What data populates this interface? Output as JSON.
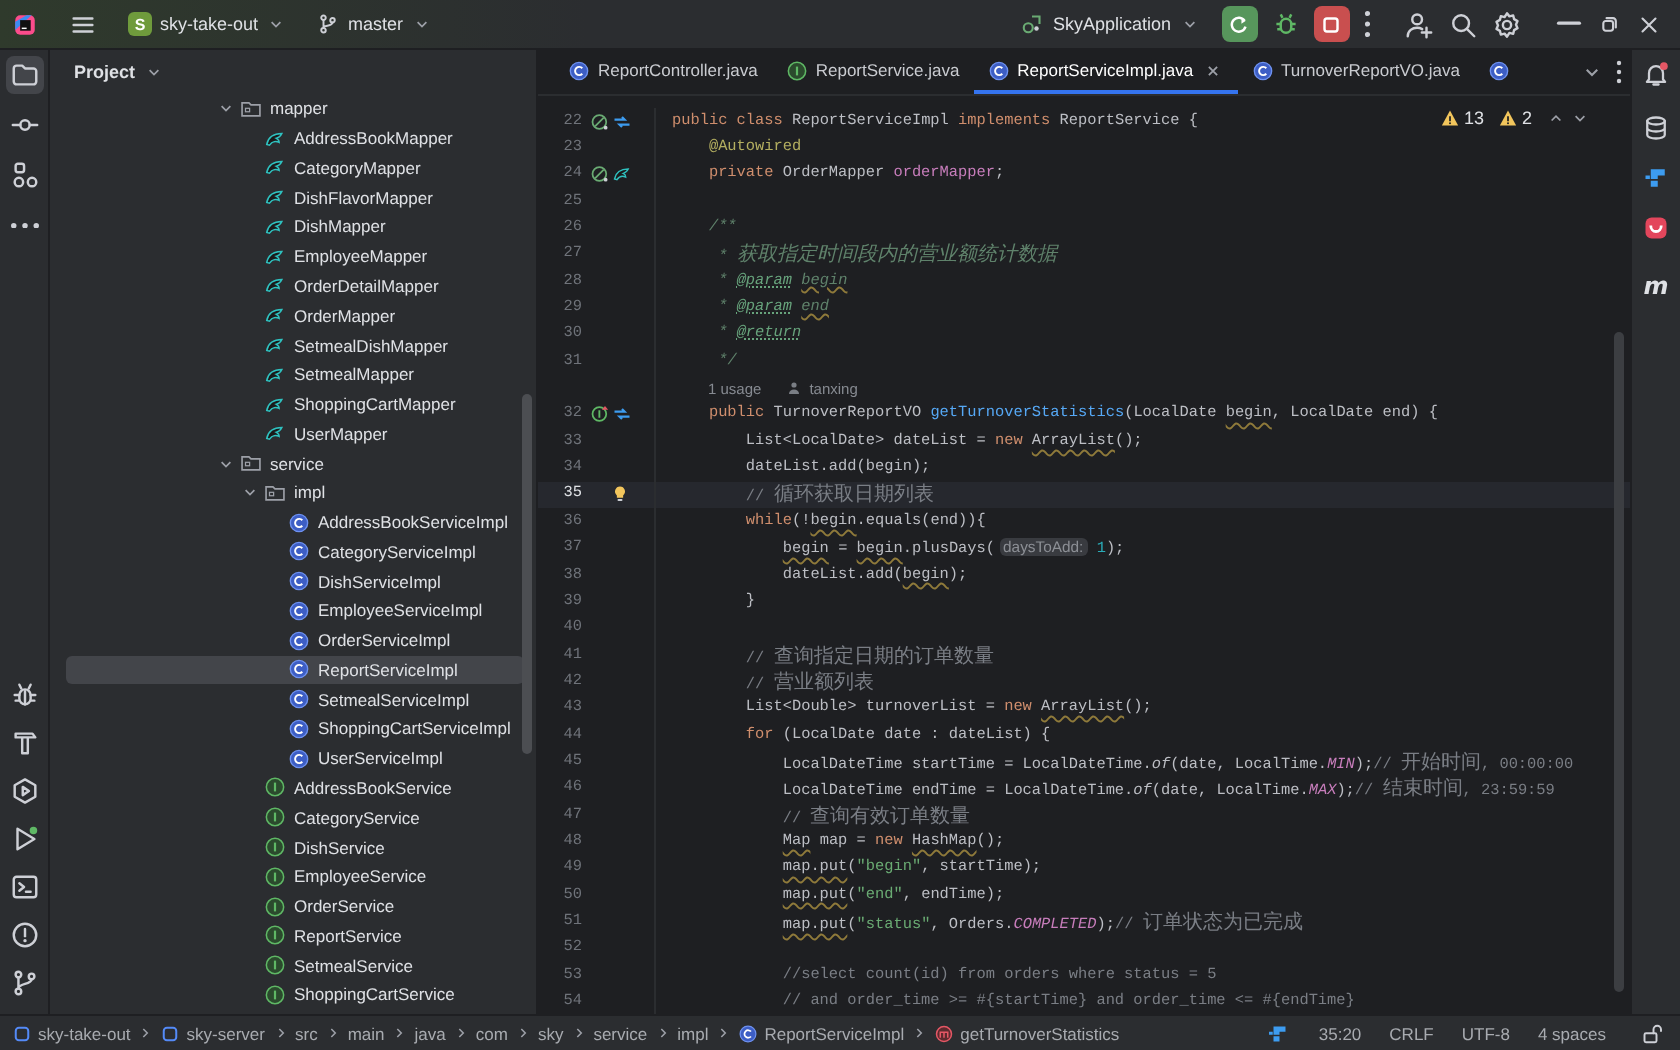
{
  "toolbar": {
    "project": {
      "badge": "S",
      "name": "sky-take-out"
    },
    "branch": "master",
    "run_config": "SkyApplication"
  },
  "tool_windows": {
    "top": [
      {
        "kind": "project",
        "selected": true
      },
      {
        "kind": "commit",
        "selected": false
      },
      {
        "kind": "structure",
        "selected": false
      },
      {
        "kind": "more",
        "selected": false
      }
    ],
    "bottom": [
      {
        "kind": "debug",
        "selected": false
      },
      {
        "kind": "build",
        "selected": false
      },
      {
        "kind": "services",
        "selected": false
      },
      {
        "kind": "run",
        "selected": false
      },
      {
        "kind": "terminal",
        "selected": false
      },
      {
        "kind": "problems",
        "selected": false
      },
      {
        "kind": "git",
        "selected": false
      }
    ]
  },
  "right_tools": [
    {
      "kind": "notifications"
    },
    {
      "kind": "database"
    },
    {
      "kind": "plugin"
    },
    {
      "kind": "app"
    },
    {
      "kind": "letter",
      "glyph": "m"
    }
  ],
  "project_panel": {
    "title": "Project",
    "tree": [
      {
        "label": "mapper",
        "kind": "folder",
        "expanded": true,
        "selected": false,
        "children": [
          {
            "label": "AddressBookMapper",
            "kind": "mapper",
            "selected": false
          },
          {
            "label": "CategoryMapper",
            "kind": "mapper",
            "selected": false
          },
          {
            "label": "DishFlavorMapper",
            "kind": "mapper",
            "selected": false
          },
          {
            "label": "DishMapper",
            "kind": "mapper",
            "selected": false
          },
          {
            "label": "EmployeeMapper",
            "kind": "mapper",
            "selected": false
          },
          {
            "label": "OrderDetailMapper",
            "kind": "mapper",
            "selected": false
          },
          {
            "label": "OrderMapper",
            "kind": "mapper",
            "selected": false
          },
          {
            "label": "SetmealDishMapper",
            "kind": "mapper",
            "selected": false
          },
          {
            "label": "SetmealMapper",
            "kind": "mapper",
            "selected": false
          },
          {
            "label": "ShoppingCartMapper",
            "kind": "mapper",
            "selected": false
          },
          {
            "label": "UserMapper",
            "kind": "mapper",
            "selected": false
          }
        ]
      },
      {
        "label": "service",
        "kind": "folder",
        "expanded": true,
        "selected": false,
        "children": [
          {
            "label": "impl",
            "kind": "folder",
            "expanded": true,
            "selected": false,
            "children": [
              {
                "label": "AddressBookServiceImpl",
                "kind": "class",
                "selected": false
              },
              {
                "label": "CategoryServiceImpl",
                "kind": "class",
                "selected": false
              },
              {
                "label": "DishServiceImpl",
                "kind": "class",
                "selected": false
              },
              {
                "label": "EmployeeServiceImpl",
                "kind": "class",
                "selected": false
              },
              {
                "label": "OrderServiceImpl",
                "kind": "class",
                "selected": false
              },
              {
                "label": "ReportServiceImpl",
                "kind": "class",
                "selected": true
              },
              {
                "label": "SetmealServiceImpl",
                "kind": "class",
                "selected": false
              },
              {
                "label": "ShoppingCartServiceImpl",
                "kind": "class",
                "selected": false
              },
              {
                "label": "UserServiceImpl",
                "kind": "class",
                "selected": false
              }
            ]
          },
          {
            "label": "AddressBookService",
            "kind": "interface",
            "selected": false
          },
          {
            "label": "CategoryService",
            "kind": "interface",
            "selected": false
          },
          {
            "label": "DishService",
            "kind": "interface",
            "selected": false
          },
          {
            "label": "EmployeeService",
            "kind": "interface",
            "selected": false
          },
          {
            "label": "OrderService",
            "kind": "interface",
            "selected": false
          },
          {
            "label": "ReportService",
            "kind": "interface",
            "selected": false
          },
          {
            "label": "SetmealService",
            "kind": "interface",
            "selected": false
          },
          {
            "label": "ShoppingCartService",
            "kind": "interface",
            "selected": false
          }
        ]
      }
    ]
  },
  "tabs": [
    {
      "label": "ReportController.java",
      "kind": "class",
      "selected": false
    },
    {
      "label": "ReportService.java",
      "kind": "interface",
      "selected": false
    },
    {
      "label": "ReportServiceImpl.java",
      "kind": "class",
      "selected": true
    },
    {
      "label": "TurnoverReportVO.java",
      "kind": "class",
      "selected": false
    },
    {
      "kind": "class",
      "selected": false
    }
  ],
  "inspections": {
    "warnings": "13",
    "weak_warnings": "2"
  },
  "editor": {
    "lines": [
      {
        "kind": "code",
        "number": "22",
        "current": false,
        "gutter": [
          {
            "kind": "bean"
          },
          {
            "kind": "hierarchy"
          }
        ],
        "tokens": [
          {
            "kind": "kw",
            "text": "public class "
          },
          {
            "kind": "plain",
            "text": "ReportServiceImpl "
          },
          {
            "kind": "kw",
            "text": "implements "
          },
          {
            "kind": "plain",
            "text": "ReportService {"
          }
        ]
      },
      {
        "kind": "code",
        "number": "23",
        "current": false,
        "tokens": [
          {
            "kind": "ann",
            "text": "    @Autowired"
          }
        ]
      },
      {
        "kind": "code",
        "number": "24",
        "current": false,
        "gutter": [
          {
            "kind": "bean"
          },
          {
            "kind": "mapper"
          }
        ],
        "tokens": [
          {
            "kind": "kw",
            "text": "    private "
          },
          {
            "kind": "plain",
            "text": "OrderMapper "
          },
          {
            "kind": "field",
            "text": "orderMapper"
          },
          {
            "kind": "plain",
            "text": ";"
          }
        ]
      },
      {
        "kind": "code",
        "number": "25",
        "current": false
      },
      {
        "kind": "code",
        "number": "26",
        "current": false,
        "tokens": [
          {
            "kind": "doc",
            "text": "    /**"
          }
        ]
      },
      {
        "kind": "code",
        "number": "27",
        "current": false,
        "tokens": [
          {
            "kind": "doc",
            "text": "     * "
          },
          {
            "kind": "doccjk",
            "text": "获取指定时间段内的营业额统计数据"
          }
        ]
      },
      {
        "kind": "code",
        "number": "28",
        "current": false,
        "tokens": [
          {
            "kind": "doc",
            "text": "     * "
          },
          {
            "kind": "doctag",
            "text": "@param"
          },
          {
            "kind": "docname",
            "text": " begin"
          }
        ]
      },
      {
        "kind": "code",
        "number": "29",
        "current": false,
        "tokens": [
          {
            "kind": "doc",
            "text": "     * "
          },
          {
            "kind": "doctag",
            "text": "@param"
          },
          {
            "kind": "docname",
            "text": " end"
          }
        ]
      },
      {
        "kind": "code",
        "number": "30",
        "current": false,
        "tokens": [
          {
            "kind": "doc",
            "text": "     * "
          },
          {
            "kind": "doctag",
            "text": "@return"
          }
        ]
      },
      {
        "kind": "code",
        "number": "31",
        "current": false,
        "tokens": [
          {
            "kind": "doc",
            "text": "     */"
          }
        ]
      },
      {
        "kind": "inlay",
        "usages": "1 usage",
        "author": "tanxing"
      },
      {
        "kind": "code",
        "number": "32",
        "current": false,
        "gutter": [
          {
            "kind": "implements"
          },
          {
            "kind": "hierarchy"
          }
        ],
        "tokens": [
          {
            "kind": "kw",
            "text": "    public "
          },
          {
            "kind": "plain",
            "text": "TurnoverReportVO "
          },
          {
            "kind": "fn",
            "text": "getTurnoverStatistics"
          },
          {
            "kind": "plain",
            "text": "(LocalDate "
          },
          {
            "kind": "warn",
            "text": "begin"
          },
          {
            "kind": "plain",
            "text": ", LocalDate end) {"
          }
        ]
      },
      {
        "kind": "code",
        "number": "33",
        "current": false,
        "tokens": [
          {
            "kind": "plain",
            "text": "        List<LocalDate> dateList = "
          },
          {
            "kind": "kw",
            "text": "new "
          },
          {
            "kind": "warn",
            "text": "ArrayList"
          },
          {
            "kind": "plain",
            "text": "();"
          }
        ]
      },
      {
        "kind": "code",
        "number": "34",
        "current": false,
        "tokens": [
          {
            "kind": "plain",
            "text": "        dateList.add(begin);"
          }
        ]
      },
      {
        "kind": "code",
        "number": "35",
        "current": true,
        "tokens": [
          {
            "kind": "comment",
            "text": "        // "
          },
          {
            "kind": "cjk",
            "text": "循环获取日期列表"
          }
        ]
      },
      {
        "kind": "code",
        "number": "36",
        "current": false,
        "tokens": [
          {
            "kind": "kw",
            "text": "        while"
          },
          {
            "kind": "plain",
            "text": "(!"
          },
          {
            "kind": "warn",
            "text": "begin"
          },
          {
            "kind": "plain",
            "text": ".equals(end)){"
          }
        ]
      },
      {
        "kind": "code",
        "number": "37",
        "current": false,
        "tokens": [
          {
            "kind": "warn",
            "text": "            begin"
          },
          {
            "kind": "plain",
            "text": " = "
          },
          {
            "kind": "warn",
            "text": "begin"
          },
          {
            "kind": "plain",
            "text": ".plusDays("
          },
          {
            "kind": "hint",
            "text": "daysToAdd:"
          },
          {
            "kind": "num",
            "text": " 1"
          },
          {
            "kind": "plain",
            "text": ");"
          }
        ]
      },
      {
        "kind": "code",
        "number": "38",
        "current": false,
        "tokens": [
          {
            "kind": "plain",
            "text": "            dateList.add("
          },
          {
            "kind": "warn",
            "text": "begin"
          },
          {
            "kind": "plain",
            "text": ");"
          }
        ]
      },
      {
        "kind": "code",
        "number": "39",
        "current": false,
        "tokens": [
          {
            "kind": "plain",
            "text": "        }"
          }
        ]
      },
      {
        "kind": "code",
        "number": "40",
        "current": false
      },
      {
        "kind": "code",
        "number": "41",
        "current": false,
        "tokens": [
          {
            "kind": "comment",
            "text": "        // "
          },
          {
            "kind": "cjk",
            "text": "查询指定日期的订单数量"
          }
        ]
      },
      {
        "kind": "code",
        "number": "42",
        "current": false,
        "tokens": [
          {
            "kind": "comment",
            "text": "        // "
          },
          {
            "kind": "cjk",
            "text": "营业额列表"
          }
        ]
      },
      {
        "kind": "code",
        "number": "43",
        "current": false,
        "tokens": [
          {
            "kind": "plain",
            "text": "        List<Double> turnoverList = "
          },
          {
            "kind": "kw",
            "text": "new "
          },
          {
            "kind": "warn",
            "text": "ArrayList"
          },
          {
            "kind": "plain",
            "text": "();"
          }
        ]
      },
      {
        "kind": "code",
        "number": "44",
        "current": false,
        "tokens": [
          {
            "kind": "kw",
            "text": "        for "
          },
          {
            "kind": "plain",
            "text": "(LocalDate date : dateList) {"
          }
        ]
      },
      {
        "kind": "code",
        "number": "45",
        "current": false,
        "tokens": [
          {
            "kind": "plain",
            "text": "            LocalDateTime startTime = LocalDateTime."
          },
          {
            "kind": "static",
            "text": "of"
          },
          {
            "kind": "plain",
            "text": "(date, LocalTime."
          },
          {
            "kind": "const",
            "text": "MIN"
          },
          {
            "kind": "plain",
            "text": ");"
          },
          {
            "kind": "comment",
            "text": "// "
          },
          {
            "kind": "cjk",
            "text": "开始时间"
          },
          {
            "kind": "comment",
            "text": ", 00:00:00"
          }
        ]
      },
      {
        "kind": "code",
        "number": "46",
        "current": false,
        "tokens": [
          {
            "kind": "plain",
            "text": "            LocalDateTime endTime = LocalDateTime."
          },
          {
            "kind": "static",
            "text": "of"
          },
          {
            "kind": "plain",
            "text": "(date, LocalTime."
          },
          {
            "kind": "const",
            "text": "MAX"
          },
          {
            "kind": "plain",
            "text": ");"
          },
          {
            "kind": "comment",
            "text": "// "
          },
          {
            "kind": "cjk",
            "text": "结束时间"
          },
          {
            "kind": "comment",
            "text": ", 23:59:59"
          }
        ]
      },
      {
        "kind": "code",
        "number": "47",
        "current": false,
        "tokens": [
          {
            "kind": "comment",
            "text": "            // "
          },
          {
            "kind": "cjk",
            "text": "查询有效订单数量"
          }
        ]
      },
      {
        "kind": "code",
        "number": "48",
        "current": false,
        "tokens": [
          {
            "kind": "warn",
            "text": "            Map"
          },
          {
            "kind": "plain",
            "text": " map = "
          },
          {
            "kind": "kw",
            "text": "new "
          },
          {
            "kind": "warn",
            "text": "HashMap"
          },
          {
            "kind": "plain",
            "text": "();"
          }
        ]
      },
      {
        "kind": "code",
        "number": "49",
        "current": false,
        "tokens": [
          {
            "kind": "warn",
            "text": "            map.put"
          },
          {
            "kind": "plain",
            "text": "("
          },
          {
            "kind": "str",
            "text": "\"begin\""
          },
          {
            "kind": "plain",
            "text": ", startTime);"
          }
        ]
      },
      {
        "kind": "code",
        "number": "50",
        "current": false,
        "tokens": [
          {
            "kind": "warn",
            "text": "            map.put"
          },
          {
            "kind": "plain",
            "text": "("
          },
          {
            "kind": "str",
            "text": "\"end\""
          },
          {
            "kind": "plain",
            "text": ", endTime);"
          }
        ]
      },
      {
        "kind": "code",
        "number": "51",
        "current": false,
        "tokens": [
          {
            "kind": "warn",
            "text": "            map.put"
          },
          {
            "kind": "plain",
            "text": "("
          },
          {
            "kind": "str",
            "text": "\"status\""
          },
          {
            "kind": "plain",
            "text": ", Orders."
          },
          {
            "kind": "const",
            "text": "COMPLETED"
          },
          {
            "kind": "plain",
            "text": ");"
          },
          {
            "kind": "comment",
            "text": "// "
          },
          {
            "kind": "cjk",
            "text": "订单状态为已完成"
          }
        ]
      },
      {
        "kind": "code",
        "number": "52",
        "current": false
      },
      {
        "kind": "code",
        "number": "53",
        "current": false,
        "tokens": [
          {
            "kind": "comment",
            "text": "            //select count(id) from orders where status = 5"
          }
        ]
      },
      {
        "kind": "code",
        "number": "54",
        "current": false,
        "tokens": [
          {
            "kind": "comment",
            "text": "            // and order_time >= #{startTime} and order_time <= #{endTime}"
          }
        ]
      }
    ]
  },
  "status_bar": {
    "breadcrumbs": [
      {
        "label": "sky-take-out",
        "kind": "module"
      },
      {
        "label": "sky-server",
        "kind": "module"
      },
      {
        "label": "src",
        "kind": "dir"
      },
      {
        "label": "main",
        "kind": "dir"
      },
      {
        "label": "java",
        "kind": "dir"
      },
      {
        "label": "com",
        "kind": "dir"
      },
      {
        "label": "sky",
        "kind": "dir"
      },
      {
        "label": "service",
        "kind": "dir"
      },
      {
        "label": "impl",
        "kind": "dir"
      },
      {
        "label": "ReportServiceImpl",
        "kind": "class"
      },
      {
        "label": "getTurnoverStatistics",
        "kind": "method"
      }
    ],
    "position": "35:20",
    "line_separator": "CRLF",
    "encoding": "UTF-8",
    "indent": "4 spaces"
  }
}
